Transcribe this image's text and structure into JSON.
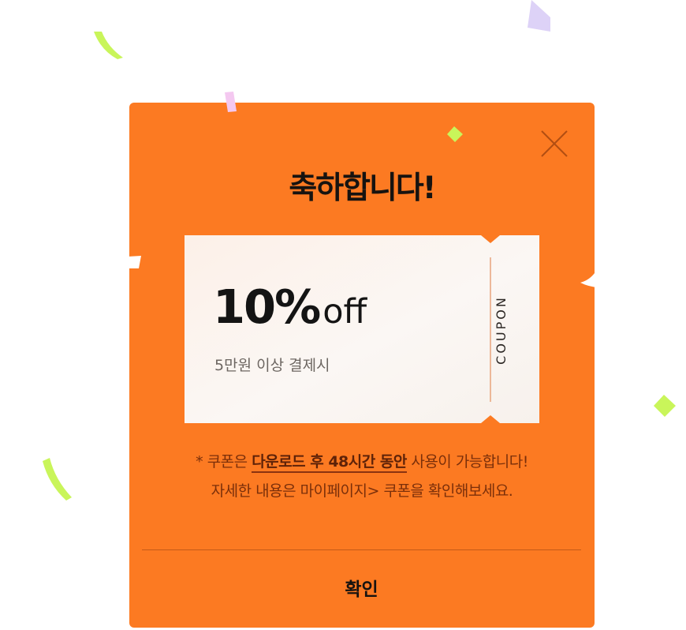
{
  "dialog": {
    "title": "축하합니다!",
    "close_icon": "close-icon",
    "coupon": {
      "discount": "10%",
      "discount_suffix": "off",
      "condition": "5만원 이상 결제시",
      "tag": "COUPON"
    },
    "notice": {
      "prefix": "* 쿠폰은 ",
      "highlight": "다운로드 후 48시간 동안",
      "suffix": " 사용이 가능합니다!",
      "line2": "자세한 내용은 마이페이지> 쿠폰을 확인해보세요."
    },
    "confirm_label": "확인"
  },
  "colors": {
    "modal_bg": "#fc7a22",
    "coupon_bg": "#fbf3ee",
    "notice_text": "#7a2f0a",
    "confetti_green": "#c9f55a",
    "confetti_pink": "#f4c8f0",
    "confetti_lavender": "#ddd2f7"
  }
}
